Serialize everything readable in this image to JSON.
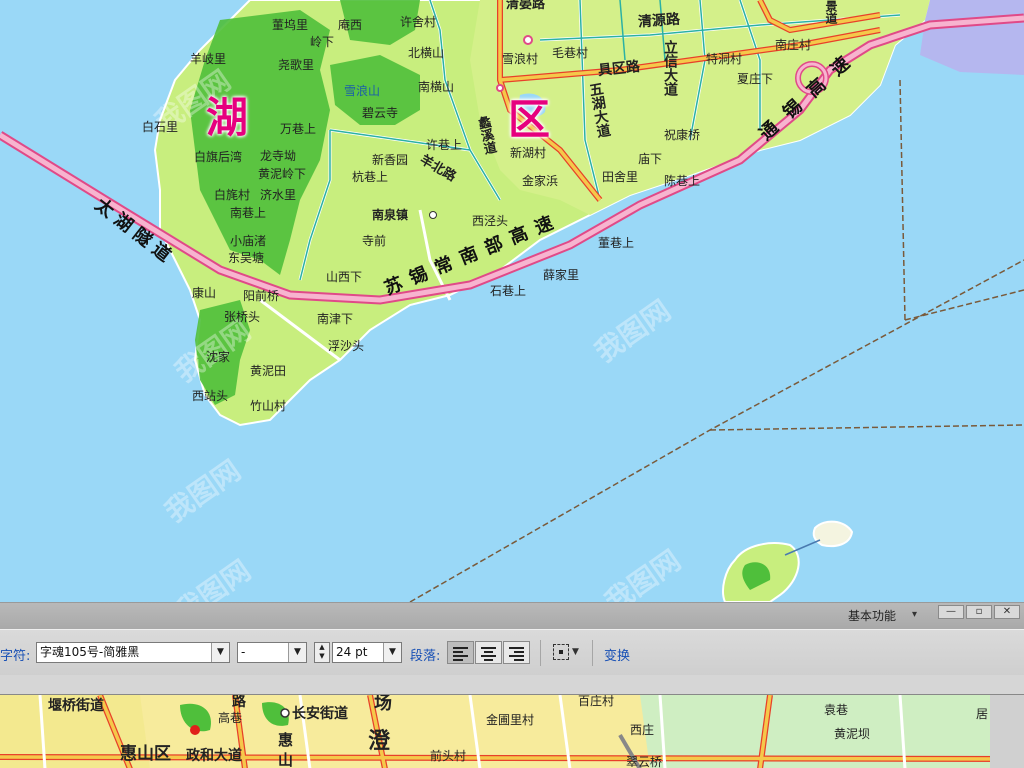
{
  "map_top": {
    "district_chars": [
      "湖",
      "区"
    ],
    "roads": {
      "taihu_tunnel": "太湖隧道",
      "suxichang": "苏锡常南部高速",
      "tongxi": "通锡高速",
      "qinghe": "清晏路",
      "qingyuan": "清源路",
      "beiqu": "具区路",
      "lixin": "立信大道",
      "wuhu": "五湖大道",
      "xiexi": "蠡溪道",
      "yangbei": "羊北路",
      "nanjing_corner": "景道"
    },
    "places": {
      "dongwuli": "董坞里",
      "anxi": "庵西",
      "xushecun": "许舍村",
      "lingxia": "岭下",
      "yangqili": "羊岐里",
      "yaogeli": "尧歌里",
      "beihengshan": "北横山",
      "xuelangcun": "雪浪村",
      "maoxiangcun": "毛巷村",
      "nanzhuangcun": "南庄村",
      "techongcun": "特洞村",
      "xiazhuangxia": "夏庄下",
      "xuelangshan": "雪浪山",
      "nanhengshan": "南横山",
      "biyunsi": "碧云寺",
      "baishili": "白石里",
      "wanxiangshang": "万巷上",
      "xuxiangshang": "许巷上",
      "xinhucun": "新湖村",
      "zhukangqiao": "祝康桥",
      "baiqihouwan": "白旗后湾",
      "longsiao": "龙寺坳",
      "xinxiangyuan": "新香园",
      "huangnilingxia": "黄泥岭下",
      "hangxiangshang": "杭巷上",
      "jinjiabang": "金家浜",
      "tianshebli": "田舍里",
      "miaoxia": "庙下",
      "chenxiangshang": "陈巷上",
      "baiqicun": "白旄村",
      "jishuili": "济水里",
      "nanxiangshang": "南巷上",
      "nanquanzhen": "南泉镇",
      "xijingtou": "西泾头",
      "siqian": "寺前",
      "dongxiangshang": "董巷上",
      "xiaomiaozhu": "小庙渚",
      "dongwutang": "东吴塘",
      "shanxixia": "山西下",
      "xuejiali": "薛家里",
      "kangshan": "康山",
      "yangqianqiao": "阳前桥",
      "shixiangshang": "石巷上",
      "zhangqiaotou": "张桥头",
      "nanjinxia": "南津下",
      "fushatou": "浮沙头",
      "shenjia": "沈家",
      "huangnitian": "黄泥田",
      "xizhantou": "西站头",
      "zhushancun": "竹山村"
    }
  },
  "toolbar": {
    "workspace_label": "基本功能",
    "workspace_caret": "▾",
    "char_label": "字符:",
    "font_family": "字魂105号-简雅黑",
    "font_style": "-",
    "font_size": "24 pt",
    "paragraph_label": "段落:",
    "transform_label": "变换",
    "dropdown_glyph": "▼",
    "spin_up": "▲",
    "spin_down": "▼"
  },
  "map_bottom": {
    "places": {
      "yanqiao": "堰桥街道",
      "gaoxiang": "高巷",
      "changan": "长安街道",
      "jingoulicun": "金圃里村",
      "huishanqu": "惠山区",
      "zhenghe": "政和大道",
      "qiantoucun": "前头村",
      "cuiyunqiao": "翠云桥",
      "yuanxiang": "袁巷",
      "huangniba": "黄泥坝",
      "baizhuangcun": "百庄村",
      "xizhuang": "西庄",
      "lu": "路",
      "hui": "惠",
      "shan": "山",
      "cheng": "澄",
      "chang": "场",
      "ju": "居"
    }
  },
  "watermark": "我图网"
}
